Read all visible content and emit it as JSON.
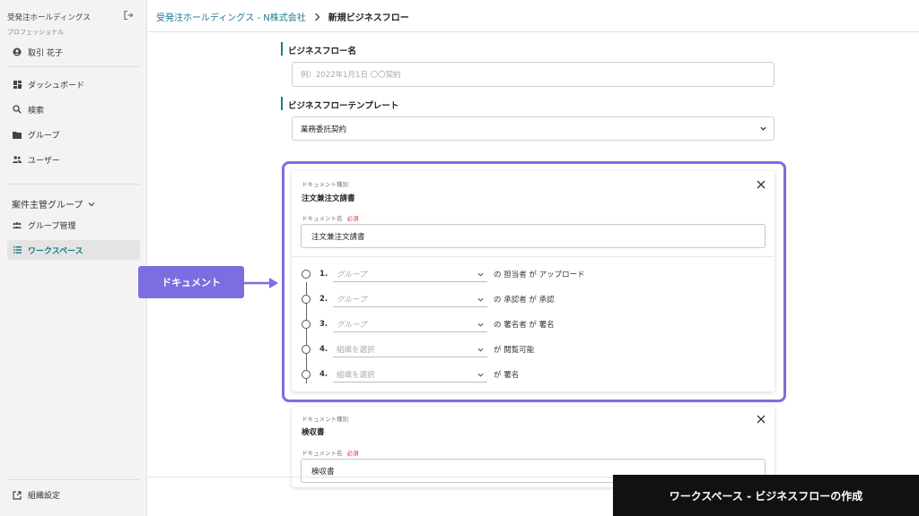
{
  "sidebar": {
    "company": "受発注ホールディングス",
    "plan": "プロフェッショナル",
    "user": "取引 花子",
    "nav": [
      {
        "label": "ダッシュボード",
        "icon": "dashboard-icon"
      },
      {
        "label": "検索",
        "icon": "search-icon"
      },
      {
        "label": "グループ",
        "icon": "folder-icon"
      },
      {
        "label": "ユーザー",
        "icon": "users-icon"
      }
    ],
    "group_header": "案件主管グループ",
    "group_items": [
      {
        "label": "グループ管理",
        "icon": "group-icon",
        "active": false
      },
      {
        "label": "ワークスペース",
        "icon": "list-icon",
        "active": true
      }
    ],
    "settings": "組織設定"
  },
  "breadcrumb": {
    "parent": "受発注ホールディングス - N株式会社",
    "current": "新規ビジネスフロー"
  },
  "form": {
    "flow_name_label": "ビジネスフロー名",
    "flow_name_placeholder": "例）2022年1月1日 〇〇契約",
    "template_label": "ビジネスフローテンプレート",
    "template_value": "業務委託契約"
  },
  "documents": [
    {
      "type_label": "ドキュメント種別",
      "type_value": "注文兼注文請書",
      "name_label": "ドキュメント名",
      "required": "必須",
      "name_value": "注文兼注文請書",
      "steps": [
        {
          "num": "1.",
          "select": "グループ",
          "text": "の 担当者 が アップロード"
        },
        {
          "num": "2.",
          "select": "グループ",
          "text": "の 承認者 が 承認"
        },
        {
          "num": "3.",
          "select": "グループ",
          "text": "の 署名者 が 署名"
        },
        {
          "num": "4.",
          "select": "組織を選択",
          "text": "が 閲覧可能"
        },
        {
          "num": "4.",
          "select": "組織を選択",
          "text": "が 署名"
        }
      ]
    },
    {
      "type_label": "ドキュメント種別",
      "type_value": "検収書",
      "name_label": "ドキュメント名",
      "required": "必須",
      "name_value": "検収書"
    }
  ],
  "callout": "ドキュメント",
  "caption": "ワークスペース - ビジネスフローの作成",
  "colors": {
    "accent": "#1a7a8e",
    "highlight": "#7b6ee0",
    "required": "#dd3333"
  }
}
